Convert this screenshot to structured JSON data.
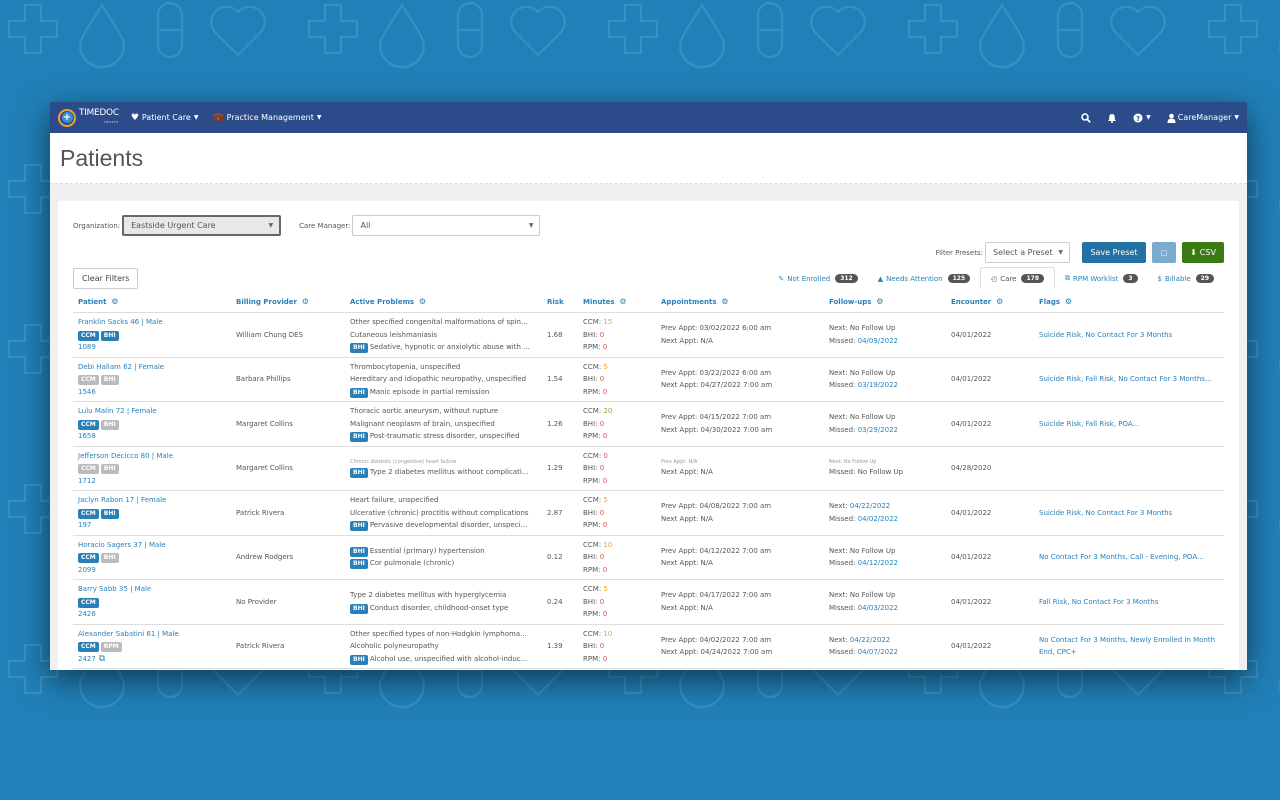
{
  "navbar": {
    "brand": "TIMEDOC",
    "brand_sub": "HEALTH",
    "items": [
      {
        "label": "Patient Care",
        "icon": "heart-pulse-icon"
      },
      {
        "label": "Practice Management",
        "icon": "briefcase-icon"
      }
    ],
    "user": "CareManager"
  },
  "page": {
    "title": "Patients"
  },
  "filters": {
    "organization_label": "Organization:",
    "organization_value": "Eastside Urgent Care",
    "care_manager_label": "Care Manager:",
    "care_manager_value": "All",
    "presets_label": "Filter Presets:",
    "preset_placeholder": "Select a Preset",
    "save_preset": "Save Preset",
    "square_button": "□",
    "csv": "CSV",
    "clear_filters": "Clear Filters"
  },
  "tabs": [
    {
      "icon": "✎",
      "label": "Not Enrolled",
      "count": "312"
    },
    {
      "icon": "▲",
      "label": "Needs Attention",
      "count": "125"
    },
    {
      "icon": "◴",
      "label": "Care",
      "count": "178",
      "active": true
    },
    {
      "icon": "⧉",
      "label": "RPM Worklist",
      "count": "3"
    },
    {
      "icon": "$",
      "label": "Billable",
      "count": "29"
    }
  ],
  "columns": [
    "Patient",
    "Billing Provider",
    "Active Problems",
    "Risk",
    "Minutes",
    "Appointments",
    "Follow-ups",
    "Encounter",
    "Flags"
  ],
  "colors": {
    "navbar": "#2b4b8a",
    "background": "#2180b8",
    "link": "#2980b9",
    "save": "#2471a3",
    "csv": "#3c7a14"
  },
  "rows": [
    {
      "name": "Franklin Sacks 46 | Male",
      "tags": [
        [
          "CCM",
          "on"
        ],
        [
          "BHI",
          "on"
        ]
      ],
      "id": "1089",
      "copy": false,
      "provider": "William Chung DES",
      "problems": [
        {
          "t": "Other specified congenital malformations of spin...",
          "bhi": false
        },
        {
          "t": "Cutaneous leishmaniasis",
          "bhi": false
        },
        {
          "t": "Sedative, hypnotic or anxiolytic abuse with ...",
          "bhi": true
        }
      ],
      "risk": "1.68",
      "ccm": "15",
      "ccm_c": "orange",
      "bhi": "0",
      "rpm": "0",
      "prev": "Prev Appt: 03/02/2022 6:00 am",
      "next": "Next Appt: N/A",
      "fu_next": "No Follow Up",
      "fu_next_link": false,
      "fu_missed": "04/09/2022",
      "fu_missed_link": true,
      "encounter": "04/01/2022",
      "flags": "Suicide Risk, No Contact For 3 Months"
    },
    {
      "name": "Debi Hallam 62 | Female",
      "tags": [
        [
          "CCM",
          "off"
        ],
        [
          "BHI",
          "off"
        ]
      ],
      "id": "1546",
      "copy": false,
      "provider": "Barbara Phillips",
      "problems": [
        {
          "t": "Thrombocytopenia, unspecified",
          "bhi": false
        },
        {
          "t": "Hereditary and idiopathic neuropathy, unspecified",
          "bhi": false
        },
        {
          "t": "Manic episode in partial remission",
          "bhi": true
        }
      ],
      "risk": "1.54",
      "ccm": "5",
      "ccm_c": "orange",
      "bhi": "0",
      "rpm": "0",
      "prev": "Prev Appt: 03/22/2022 6:00 am",
      "next": "Next Appt: 04/27/2022 7:00 am",
      "fu_next": "No Follow Up",
      "fu_next_link": false,
      "fu_missed": "03/19/2022",
      "fu_missed_link": true,
      "encounter": "04/01/2022",
      "flags": "Suicide Risk, Fall Risk, No Contact For 3 Months..."
    },
    {
      "name": "Lulu Malin 72 | Female",
      "tags": [
        [
          "CCM",
          "on"
        ],
        [
          "BHI",
          "off"
        ]
      ],
      "id": "1658",
      "copy": false,
      "provider": "Margaret Collins",
      "problems": [
        {
          "t": "Thoracic aortic aneurysm, without rupture",
          "bhi": false
        },
        {
          "t": "Malignant neoplasm of brain, unspecified",
          "bhi": false
        },
        {
          "t": "Post-traumatic stress disorder, unspecified",
          "bhi": true
        }
      ],
      "risk": "1.26",
      "ccm": "20",
      "ccm_c": "green",
      "bhi": "0",
      "rpm": "0",
      "prev": "Prev Appt: 04/15/2022 7:00 am",
      "next": "Next Appt: 04/30/2022 7:00 am",
      "fu_next": "No Follow Up",
      "fu_next_link": false,
      "fu_missed": "03/29/2022",
      "fu_missed_link": true,
      "encounter": "04/01/2022",
      "flags": "Suicide Risk, Fall Risk, POA..."
    },
    {
      "name": "Jefferson Decicco 80 | Male",
      "tags": [
        [
          "CCM",
          "off"
        ],
        [
          "BHI",
          "off"
        ]
      ],
      "id": "1712",
      "copy": false,
      "provider": "Margaret Collins",
      "problems": [
        {
          "t": "Chronic diastolic (congestive) heart failure",
          "bhi": false,
          "faded": true
        },
        {
          "t": "Type 2 diabetes mellitus without complicati...",
          "bhi": true
        }
      ],
      "risk": "1.29",
      "ccm": "0",
      "ccm_c": "red",
      "bhi": "0",
      "rpm": "0",
      "prev": "Prev Appt: N/A",
      "prev_faded": true,
      "next": "Next Appt: N/A",
      "fu_next": "No Follow Up",
      "fu_next_link": false,
      "fu_next_faded": true,
      "fu_missed": "No Follow Up",
      "fu_missed_link": false,
      "encounter": "04/28/2020",
      "flags": ""
    },
    {
      "name": "Jaclyn Rabon 17 | Female",
      "tags": [
        [
          "CCM",
          "on"
        ],
        [
          "BHI",
          "on"
        ]
      ],
      "id": "197",
      "copy": false,
      "provider": "Patrick Rivera",
      "problems": [
        {
          "t": "Heart failure, unspecified",
          "bhi": false
        },
        {
          "t": "Ulcerative (chronic) proctitis without complications",
          "bhi": false
        },
        {
          "t": "Pervasive developmental disorder, unspeci...",
          "bhi": true
        }
      ],
      "risk": "2.87",
      "ccm": "5",
      "ccm_c": "orange",
      "bhi": "0",
      "rpm": "0",
      "prev": "Prev Appt: 04/08/2022 7:00 am",
      "next": "Next Appt: N/A",
      "fu_next": "04/22/2022",
      "fu_next_link": true,
      "fu_missed": "04/02/2022",
      "fu_missed_link": true,
      "encounter": "04/01/2022",
      "flags": "Suicide Risk, No Contact For 3 Months"
    },
    {
      "name": "Horacio Sagers 37 | Male",
      "tags": [
        [
          "CCM",
          "on"
        ],
        [
          "BHI",
          "off"
        ]
      ],
      "id": "2099",
      "copy": false,
      "provider": "Andrew Rodgers",
      "problems": [
        {
          "t": "Essential (primary) hypertension",
          "bhi": true
        },
        {
          "t": "Cor pulmonale (chronic)",
          "bhi": true
        }
      ],
      "risk": "0.12",
      "ccm": "10",
      "ccm_c": "orange",
      "bhi": "0",
      "rpm": "0",
      "prev": "Prev Appt: 04/12/2022 7:00 am",
      "next": "Next Appt: N/A",
      "fu_next": "No Follow Up",
      "fu_next_link": false,
      "fu_missed": "04/12/2022",
      "fu_missed_link": true,
      "encounter": "04/01/2022",
      "flags": "No Contact For 3 Months, Call - Evening, POA..."
    },
    {
      "name": "Barry Sabb 35 | Male",
      "tags": [
        [
          "CCM",
          "on"
        ]
      ],
      "id": "2426",
      "copy": false,
      "provider": "No Provider",
      "problems": [
        {
          "t": "Type 2 diabetes mellitus with hyperglycemia",
          "bhi": false
        },
        {
          "t": "Conduct disorder, childhood-onset type",
          "bhi": true
        }
      ],
      "risk": "0.24",
      "ccm": "5",
      "ccm_c": "orange",
      "bhi": "0",
      "rpm": "0",
      "prev": "Prev Appt: 04/17/2022 7:00 am",
      "next": "Next Appt: N/A",
      "fu_next": "No Follow Up",
      "fu_next_link": false,
      "fu_missed": "04/03/2022",
      "fu_missed_link": true,
      "encounter": "04/01/2022",
      "flags": "Fall Risk, No Contact For 3 Months"
    },
    {
      "name": "Alexander Sabatini 61 | Male",
      "tags": [
        [
          "CCM",
          "on"
        ],
        [
          "RPM",
          "off"
        ]
      ],
      "id": "2427",
      "copy": true,
      "provider": "Patrick Rivera",
      "problems": [
        {
          "t": "Other specified types of non-Hodgkin lymphoma...",
          "bhi": false
        },
        {
          "t": "Alcoholic polyneuropathy",
          "bhi": false
        },
        {
          "t": "Alcohol use, unspecified with alcohol-induc...",
          "bhi": true
        }
      ],
      "risk": "1.39",
      "ccm": "10",
      "ccm_c": "orange",
      "bhi": "0",
      "rpm": "0",
      "prev": "Prev Appt: 04/02/2022 7:00 am",
      "next": "Next Appt: 04/24/2022 7:00 am",
      "fu_next": "04/22/2022",
      "fu_next_link": true,
      "fu_missed": "04/07/2022",
      "fu_missed_link": true,
      "encounter": "04/01/2022",
      "flags": "No Contact For 3 Months, Newly Enrolled In Month End, CPC+"
    }
  ]
}
